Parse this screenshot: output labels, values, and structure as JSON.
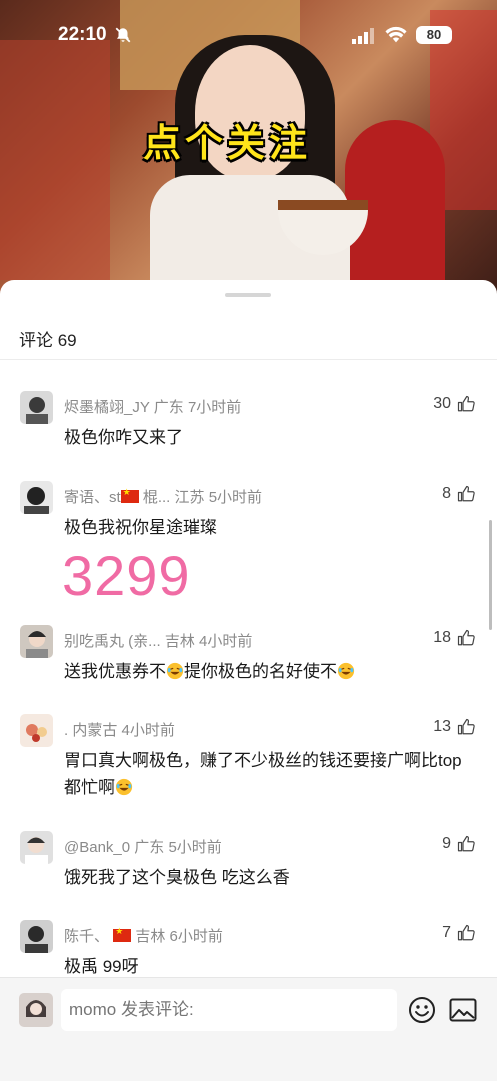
{
  "status_bar": {
    "time": "22:10",
    "battery": "80"
  },
  "video": {
    "overlay_text": "点个关注"
  },
  "comments_panel": {
    "title": "评论 69",
    "comments": [
      {
        "user": "烬墨橘翊_JY",
        "location": "广东",
        "time": "7小时前",
        "likes": "30",
        "text": "极色你咋又来了"
      },
      {
        "user_prefix": "寄语、st",
        "user_suffix": "棍...",
        "location": "江苏",
        "time": "5小时前",
        "likes": "8",
        "text": "极色我祝你星途璀璨",
        "big_number": "3299"
      },
      {
        "user": "别吃禹丸 (亲...",
        "location": "吉林",
        "time": "4小时前",
        "likes": "18",
        "text_part1": "送我优惠券不",
        "text_part2": "提你极色的名好使不"
      },
      {
        "user": ".",
        "location": "内蒙古",
        "time": "4小时前",
        "likes": "13",
        "text": "胃口真大啊极色，赚了不少极丝的钱还要接广啊比top都忙啊"
      },
      {
        "user": "@Bank_0",
        "location": "广东",
        "time": "5小时前",
        "likes": "9",
        "text": "饿死我了这个臭极色 吃这么香"
      },
      {
        "user_prefix": "陈千、",
        "user_suffix": "",
        "location": "吉林",
        "time": "6小时前",
        "likes": "7",
        "text": "极禹 99呀"
      }
    ]
  },
  "input_bar": {
    "placeholder": "momo 发表评论:"
  },
  "icons": {
    "thumb": "thumbs-up-icon",
    "emoji": "smiley-icon",
    "image": "image-icon",
    "bell_off": "bell-off-icon"
  },
  "colors": {
    "accent_pink": "#f06ba4",
    "overlay_yellow": "#ffe41a",
    "flag_red": "#de2910"
  }
}
